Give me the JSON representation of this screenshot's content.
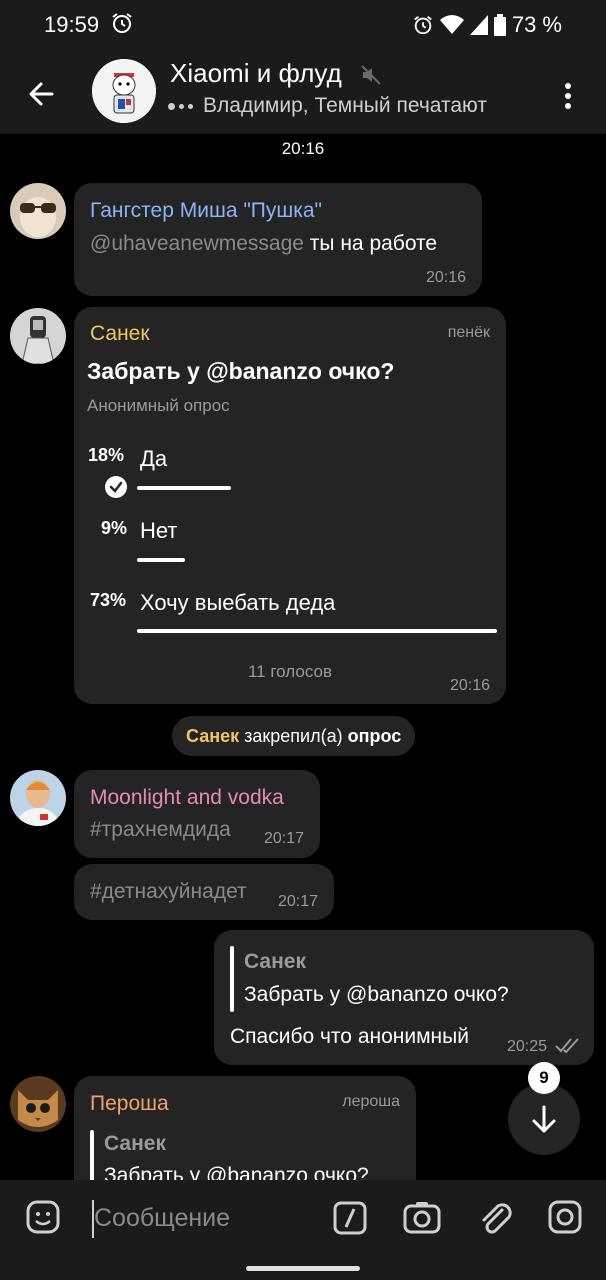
{
  "status_bar": {
    "time": "19:59",
    "battery": "73 %"
  },
  "chat": {
    "title": "Xiaomi и флуд",
    "subtitle": "Владимир, Темный печатают"
  },
  "date_label": "20:16",
  "messages": {
    "m1": {
      "sender": "Гангстер Миша \"Пушка\"",
      "mention": "@uhaveanewmessage",
      "text": " ты на работе",
      "time": "20:16"
    },
    "poll": {
      "sender": "Санек",
      "tag": "пенёк",
      "question": "Забрать у @bananzo очко?",
      "type": "Анонимный опрос",
      "options": [
        {
          "pct": "18%",
          "label": "Да",
          "value": 18
        },
        {
          "pct": "9%",
          "label": "Нет",
          "value": 9
        },
        {
          "pct": "73%",
          "label": "Хочу выебать деда",
          "value": 73
        }
      ],
      "votes": "11 голосов",
      "time": "20:16"
    },
    "service": {
      "name": "Санек",
      "action": " закрепил(а) ",
      "object": "опрос"
    },
    "m3": {
      "sender": "Moonlight and vodka",
      "text": "#трахнемдида",
      "time": "20:17"
    },
    "m4": {
      "text": "#детнахуйнадет",
      "time": "20:17"
    },
    "m5": {
      "reply_name": "Санек",
      "reply_text": "Забрать у @bananzo очко?",
      "text": "Спасибо что анонимный",
      "time": "20:25"
    },
    "m6": {
      "sender": "Пероша",
      "tag": "лероша",
      "reply_name": "Санек",
      "reply_text": "Забрать у @bananzo очко?"
    }
  },
  "scroll_badge": "9",
  "input": {
    "placeholder": "Сообщение"
  },
  "colors": {
    "sender_blue": "#8ab4f8",
    "sender_yellow": "#f0c75e",
    "sender_pink": "#e58ab4",
    "sender_orange": "#f3a26b"
  }
}
